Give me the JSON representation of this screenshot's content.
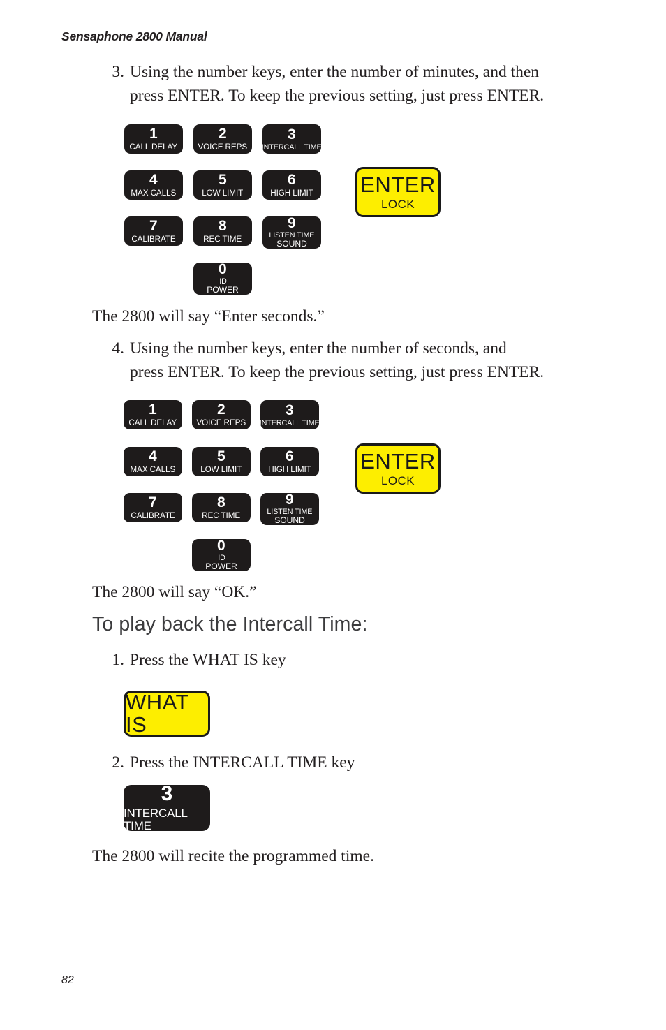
{
  "document": {
    "running_head": "Sensaphone 2800 Manual",
    "page_number": "82"
  },
  "steps": {
    "step3": {
      "number": "3.",
      "line1": "Using the number keys, enter the number of minutes, and then",
      "line2": "press ENTER. To keep the previous setting, just press ENTER."
    },
    "step4": {
      "number": "4.",
      "line1": "Using the number keys, enter the number of seconds, and",
      "line2": "press ENTER. To keep the previous setting, just press ENTER."
    },
    "playback1": {
      "number": "1.",
      "text": "Press the WHAT IS key"
    },
    "playback2": {
      "number": "2.",
      "text": "Press the INTERCALL TIME key"
    }
  },
  "narration": {
    "enter_seconds": "The 2800 will say “Enter seconds.”",
    "ok": "The 2800 will say “OK.”",
    "recite": "The 2800 will recite the programmed time."
  },
  "headings": {
    "playback": "To play back the Intercall Time:"
  },
  "keypad": {
    "keys": [
      {
        "digit": "1",
        "label": "CALL DELAY",
        "label2": ""
      },
      {
        "digit": "2",
        "label": "VOICE REPS",
        "label2": ""
      },
      {
        "digit": "3",
        "label": "INTERCALL TIME",
        "label2": ""
      },
      {
        "digit": "4",
        "label": "MAX CALLS",
        "label2": ""
      },
      {
        "digit": "5",
        "label": "LOW LIMIT",
        "label2": ""
      },
      {
        "digit": "6",
        "label": "HIGH LIMIT",
        "label2": ""
      },
      {
        "digit": "7",
        "label": "CALIBRATE",
        "label2": ""
      },
      {
        "digit": "8",
        "label": "REC TIME",
        "label2": ""
      },
      {
        "digit": "9",
        "label": "LISTEN TIME",
        "label2": "SOUND"
      },
      {
        "digit": "0",
        "label": "ID",
        "label2": "POWER"
      }
    ],
    "enter_key": {
      "main": "ENTER",
      "sub": "LOCK"
    }
  },
  "standalone_keys": {
    "what_is": {
      "main": "WHAT IS"
    },
    "intercall_time": {
      "digit": "3",
      "label": "INTERCALL TIME"
    }
  },
  "colors": {
    "key_black": "#1e1b1b",
    "key_yellow": "#fdee00",
    "text": "#231f20",
    "heading": "#3b3b3d"
  }
}
